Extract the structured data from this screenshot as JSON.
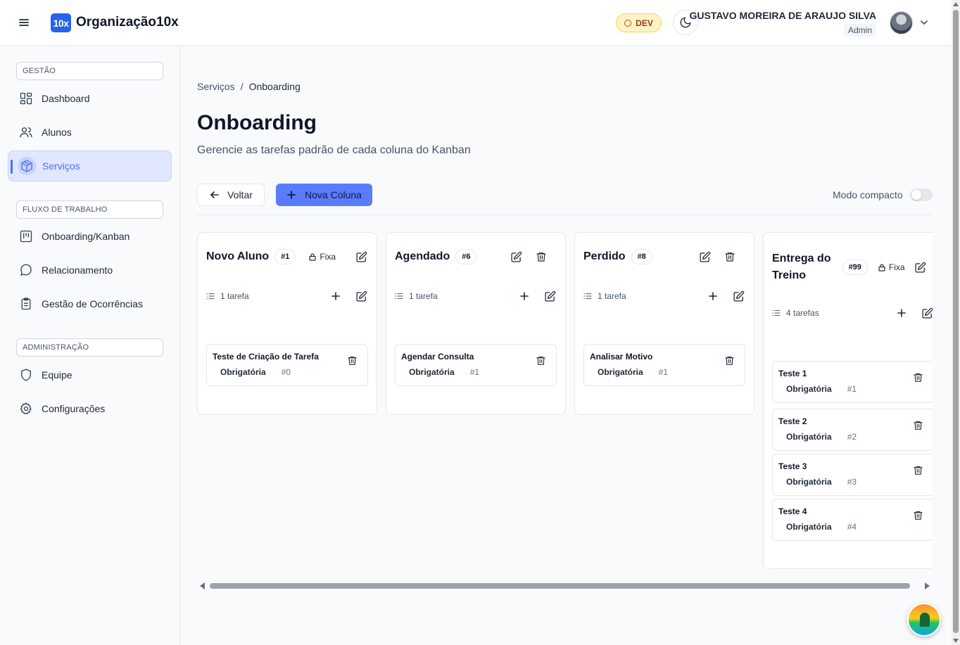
{
  "header": {
    "brand_badge": "10x",
    "brand_name": "Organização10x",
    "env_label": "DEV",
    "user_name": "GUSTAVO MOREIRA DE ARAUJO SILVA",
    "user_role": "Admin"
  },
  "sidebar": {
    "sections": {
      "gestao": "GESTÃO",
      "fluxo": "FLUXO DE TRABALHO",
      "admin": "ADMINISTRAÇÃO"
    },
    "items": {
      "dashboard": "Dashboard",
      "alunos": "Alunos",
      "servicos": "Serviços",
      "onboarding": "Onboarding/Kanban",
      "relacionamento": "Relacionamento",
      "ocorrencias": "Gestão de Ocorrências",
      "equipe": "Equipe",
      "configuracoes": "Configurações"
    },
    "active": "servicos"
  },
  "breadcrumb": {
    "parent": "Serviços",
    "separator": "/",
    "current": "Onboarding"
  },
  "page": {
    "title": "Onboarding",
    "subtitle": "Gerencie as tarefas padrão de cada coluna do Kanban"
  },
  "toolbar": {
    "back_label": "Voltar",
    "new_column_label": "Nova Coluna",
    "compact_label": "Modo compacto",
    "compact_on": false
  },
  "columns": [
    {
      "title": "Novo Aluno",
      "number": "#1",
      "fixed_label": "Fixa",
      "count_label": "1 tarefa",
      "tasks": [
        {
          "name": "Teste de Criação de Tarefa",
          "type": "Obrigatória",
          "number": "#0"
        }
      ]
    },
    {
      "title": "Agendado",
      "number": "#6",
      "count_label": "1 tarefa",
      "tasks": [
        {
          "name": "Agendar Consulta",
          "type": "Obrigatória",
          "number": "#1"
        }
      ]
    },
    {
      "title": "Perdido",
      "number": "#8",
      "count_label": "1 tarefa",
      "tasks": [
        {
          "name": "Analisar Motivo",
          "type": "Obrigatória",
          "number": "#1"
        }
      ]
    },
    {
      "title_line1": "Entrega do",
      "title_line2": "Treino",
      "number": "#99",
      "fixed_label": "Fixa",
      "count_label": "4 tarefas",
      "tasks": [
        {
          "name": "Teste 1",
          "type": "Obrigatória",
          "number": "#1"
        },
        {
          "name": "Teste 2",
          "type": "Obrigatória",
          "number": "#2"
        },
        {
          "name": "Teste 3",
          "type": "Obrigatória",
          "number": "#3"
        },
        {
          "name": "Teste 4",
          "type": "Obrigatória",
          "number": "#4"
        }
      ]
    }
  ],
  "colors": {
    "primary": "#5b7cfa",
    "brand": "#2563eb",
    "active_bg": "#e0e7ff",
    "dev_bg": "#fef3c7"
  }
}
